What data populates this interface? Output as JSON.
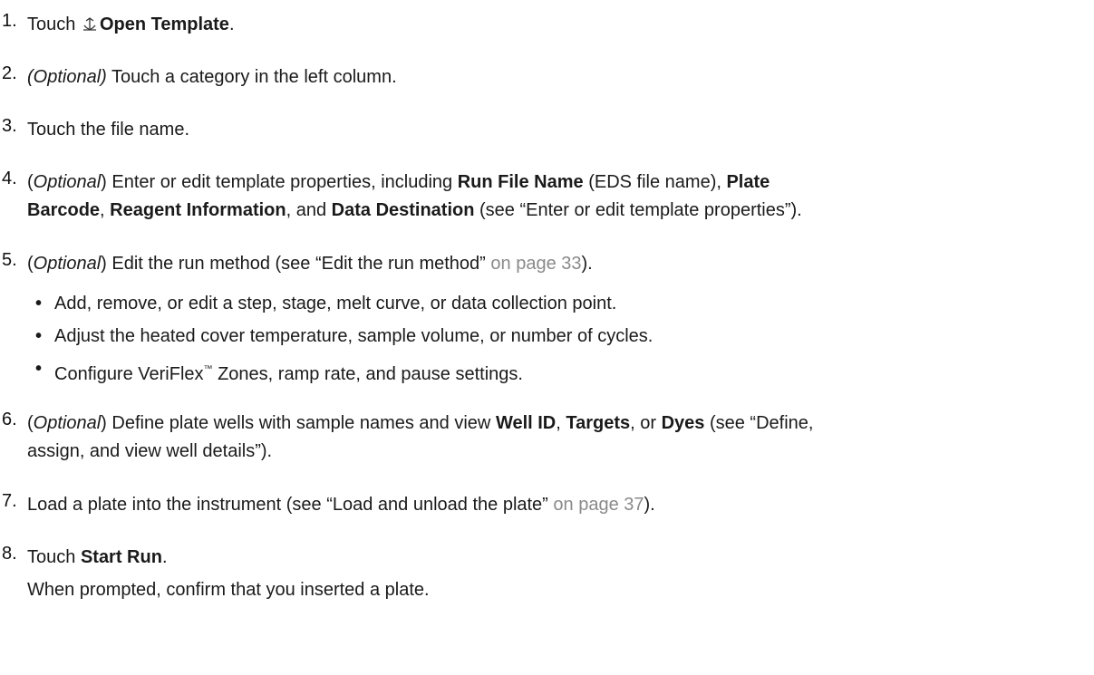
{
  "steps": [
    {
      "number": "1.",
      "pre": "Touch",
      "bold": "Open Template",
      "post": ".",
      "icon": "open-template-icon"
    },
    {
      "number": "2.",
      "italic": "(Optional)",
      "text": " Touch a category in the left column."
    },
    {
      "number": "3.",
      "text": "Touch the file name."
    },
    {
      "number": "4.",
      "p1": "(",
      "italic": "Optional",
      "p2": ") Enter or edit template properties, including ",
      "b1": "Run File Name",
      "p3": " (EDS file name), ",
      "b2": "Plate",
      "b2b": "Barcode",
      "p4": ", ",
      "b3": "Reagent Information",
      "p5": ", and ",
      "b4": "Data Destination",
      "p6": " (see “Enter or edit template properties”)."
    },
    {
      "number": "5.",
      "p1": "(",
      "italic": "Optional",
      "p2": ") Edit the run method (see “Edit the run method”",
      "link": " on page 33",
      "p3": ").",
      "bullets": [
        "Add, remove, or edit a step, stage, melt curve, or data collection point.",
        "Adjust the heated cover temperature, sample volume, or number of cycles."
      ],
      "bullet3_pre": "Configure VeriFlex",
      "bullet3_tm": "™",
      "bullet3_post": " Zones, ramp rate, and pause settings."
    },
    {
      "number": "6.",
      "p1": "(",
      "italic": "Optional",
      "p2": ") Define plate wells with sample names and view ",
      "b1": "Well ID",
      "p3": ", ",
      "b2": "Targets",
      "p4": ", or ",
      "b3": "Dyes",
      "p5": " (see “Define,",
      "p6": "assign, and view well details”)."
    },
    {
      "number": "7.",
      "text": "Load a plate into the instrument (see “Load and unload the plate”",
      "link": " on page 37",
      "post": ")."
    },
    {
      "number": "8.",
      "pre": "Touch ",
      "bold": "Start Run",
      "post": ".",
      "sub": "When prompted, confirm that you inserted a plate."
    }
  ],
  "bullet_char": "•",
  "link_color": "#8a8a8a"
}
